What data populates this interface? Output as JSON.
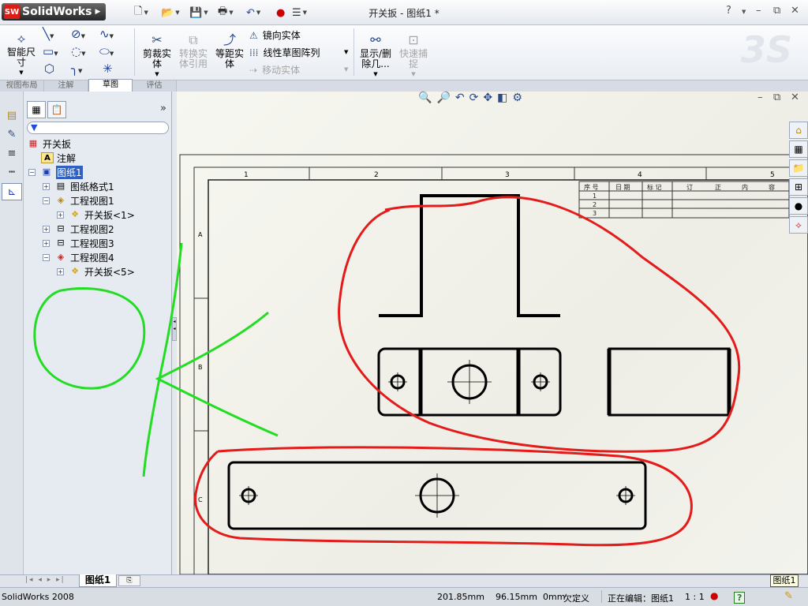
{
  "titlebar": {
    "app_name": "SolidWorks",
    "window_title": "开关扳 - 图纸1 *",
    "help": "?",
    "minimize": "–",
    "restore": "⧉",
    "close": "✕"
  },
  "ribbon": {
    "smart_dim": "智能尺\n寸",
    "trim": "剪裁实\n体",
    "convert": "转换实\n体引用",
    "offset": "等距实\n体",
    "mirror": "镜向实体",
    "linear_pattern": "线性草图阵列",
    "move": "移动实体",
    "display_delete": "显示/删\n除几...",
    "quick_snap": "快速捕\n捉"
  },
  "tabs": [
    "视图布局",
    "注解",
    "草图",
    "评估"
  ],
  "active_tab": "草图",
  "tree": {
    "root": "开关扳",
    "annotations": "注解",
    "sheet": "图纸1",
    "sheet_format": "图纸格式1",
    "view1": "工程视图1",
    "view1_part": "开关扳<1>",
    "view2": "工程视图2",
    "view3": "工程视图3",
    "view4": "工程视图4",
    "view4_part": "开关扳<5>"
  },
  "drawing": {
    "col_labels": [
      "1",
      "2",
      "3",
      "4",
      "5"
    ],
    "row_labels": [
      "A",
      "B",
      "C"
    ],
    "rev_headers": [
      "序 号",
      "日 期",
      "标 记",
      "订",
      "正",
      "内",
      "容"
    ],
    "rev_rows": [
      "1",
      "2",
      "3"
    ]
  },
  "sheetbar": {
    "sheet_tab": "图纸1",
    "tooltip": "图纸1"
  },
  "status": {
    "app_version": "SolidWorks 2008",
    "x": "201.85mm",
    "y": "96.15mm",
    "z": "0mm",
    "defined_state": "欠定义",
    "editing": "正在编辑：图纸1",
    "scale": "1 : 1",
    "help_icon": "?"
  },
  "colors": {
    "annotation_red": "#e41b1b",
    "annotation_green": "#22dd22",
    "selection_blue": "#3161c0"
  }
}
